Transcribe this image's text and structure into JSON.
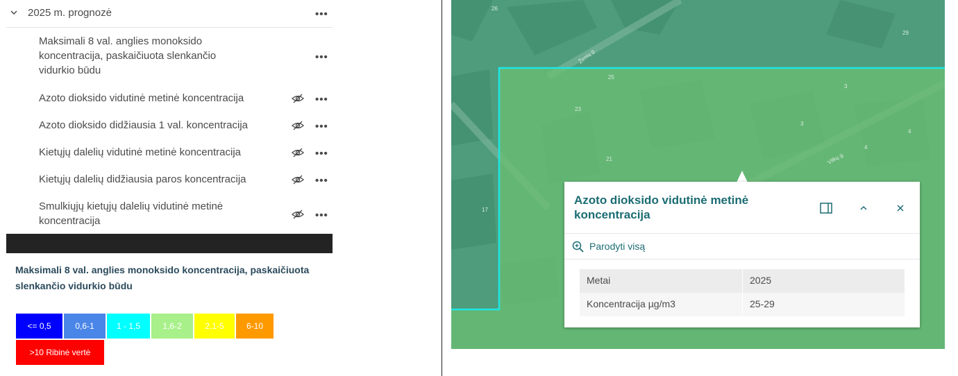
{
  "layer_list": {
    "group_title": "2025 m. prognozė",
    "items": [
      {
        "label": "Maksimali 8 val. anglies monoksido koncentracija, paskaičiuota slenkančio vidurkio būdu",
        "visible": true
      },
      {
        "label": "Azoto dioksido vidutinė metinė koncentracija",
        "visible": false
      },
      {
        "label": "Azoto dioksido didžiausia 1 val. koncentracija",
        "visible": false
      },
      {
        "label": "Kietųjų dalelių vidutinė metinė koncentracija",
        "visible": false
      },
      {
        "label": "Kietųjų dalelių didžiausia paros koncentracija",
        "visible": false
      },
      {
        "label": "Smulkiųjų kietųjų dalelių vidutinė metinė koncentracija",
        "visible": false
      }
    ],
    "more_icon": "ellipsis-icon",
    "hidden_icon": "eye-off-icon"
  },
  "legend": {
    "title": "Maksimali 8 val. anglies monoksido koncentracija, paskaičiuota slenkančio vidurkio būdu",
    "classes": [
      {
        "label": "<= 0,5",
        "color": "#0000ff",
        "text_color": "#ffffff"
      },
      {
        "label": "0,6-1",
        "color": "#4a86e8",
        "text_color": "#ffffff"
      },
      {
        "label": "1 - 1,5",
        "color": "#00ffff",
        "text_color": "#ffffff"
      },
      {
        "label": "1,6-2",
        "color": "#a8f08a",
        "text_color": "#ffffff"
      },
      {
        "label": "2,1-5",
        "color": "#ffff00",
        "text_color": "#ffffff"
      },
      {
        "label": "6-10",
        "color": "#ff9900",
        "text_color": "#ffffff"
      },
      {
        "label": ">10 Ribinė vertė",
        "color": "#ff0000",
        "text_color": "#ffffff"
      }
    ]
  },
  "map": {
    "labels": {
      "n26": "26",
      "n25": "25",
      "n23": "23",
      "n21": "21",
      "n17": "17",
      "n3a": "3",
      "n3b": "3",
      "n4a": "4",
      "n4b": "4",
      "n29": "29",
      "street1": "Žirnių g.",
      "street2": "Vilkų g."
    },
    "colors": {
      "highlight": "#1ee6e6",
      "base": "#4e9c7c",
      "selected_fill": "#6cbf72"
    }
  },
  "popup": {
    "title": "Azoto dioksido vidutinė metinė koncentracija",
    "dock_icon": "dock-icon",
    "collapse_icon": "chevron-up-icon",
    "close_icon": "close-icon",
    "zoom_label": "Parodyti visą",
    "zoom_icon": "zoom-in-icon",
    "attributes": [
      {
        "key": "Metai",
        "value": "2025"
      },
      {
        "key": "Koncentracija µg/m3",
        "value": "25-29"
      }
    ]
  }
}
